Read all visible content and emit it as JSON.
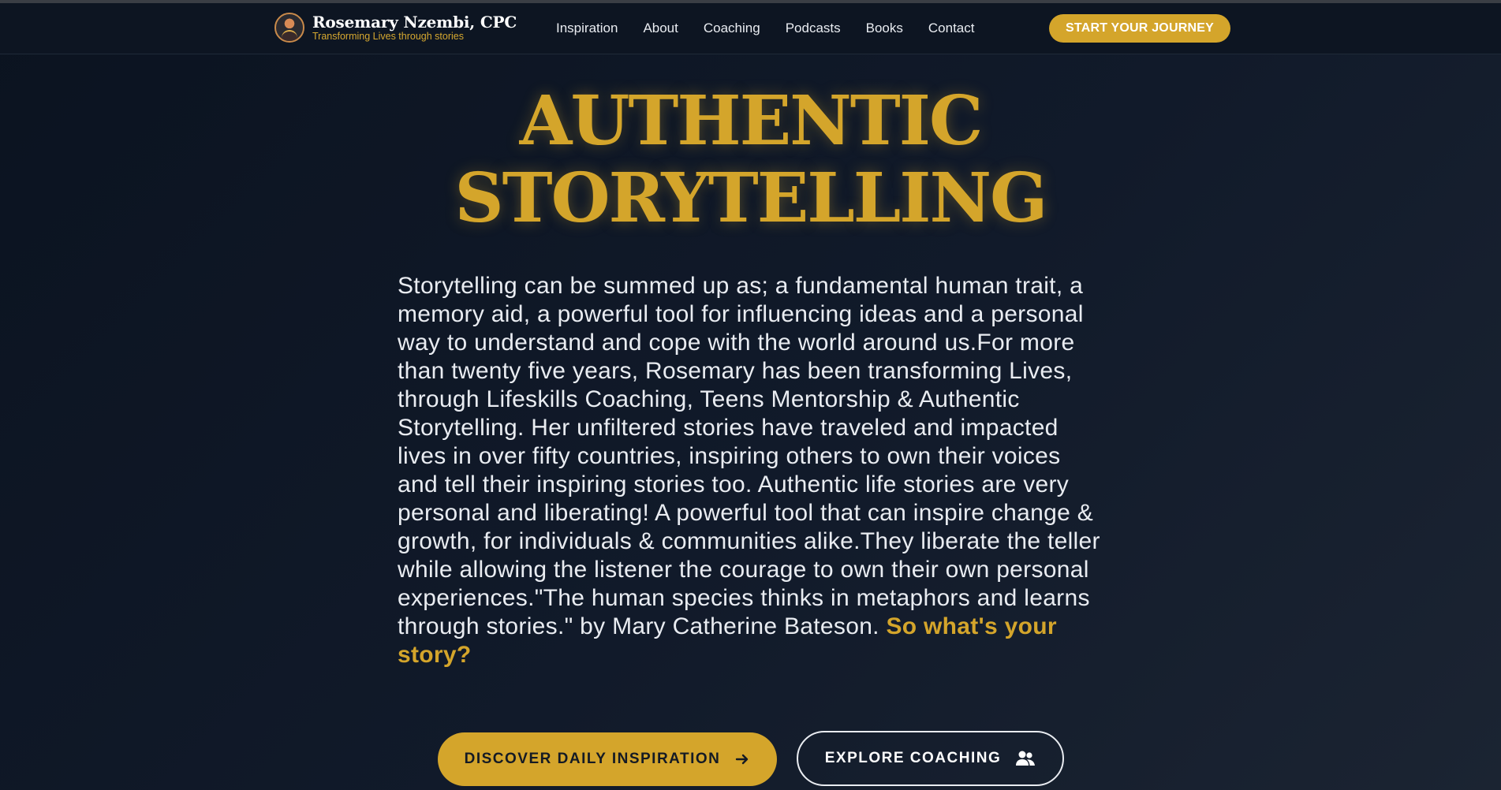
{
  "brand": {
    "name": "Rosemary Nzembi, CPC",
    "tagline": "Transforming Lives through stories"
  },
  "nav": {
    "items": [
      {
        "label": "Inspiration"
      },
      {
        "label": "About"
      },
      {
        "label": "Coaching"
      },
      {
        "label": "Podcasts"
      },
      {
        "label": "Books"
      },
      {
        "label": "Contact"
      }
    ],
    "cta_label": "START YOUR JOURNEY"
  },
  "hero": {
    "title_line1": "AUTHENTIC",
    "title_line2": "STORYTELLING",
    "body": "Storytelling can be summed up as; a fundamental human trait, a memory aid, a powerful tool for influencing ideas and a personal way to understand and cope with the world around us.For more than twenty five years, Rosemary has been transforming Lives, through Lifeskills Coaching, Teens Mentorship & Authentic Storytelling. Her unfiltered stories have traveled and impacted lives in over fifty countries, inspiring others to own their voices and tell their inspiring stories too. Authentic life stories are very personal and liberating! A powerful tool that can inspire change & growth, for individuals & communities alike.They liberate the teller while allowing the listener the courage to own their own personal experiences.\"The human species thinks in metaphors and learns through stories.\" by Mary Catherine Bateson.",
    "highlight": "So what's your story?",
    "primary_button": "DISCOVER DAILY INSPIRATION",
    "secondary_button": "EXPLORE COACHING"
  },
  "colors": {
    "accent": "#d4a52b",
    "background": "#0b1320",
    "text": "#e9ecf1"
  },
  "icons": {
    "primary_button_icon": "arrow-right-icon",
    "secondary_button_icon": "users-icon"
  }
}
